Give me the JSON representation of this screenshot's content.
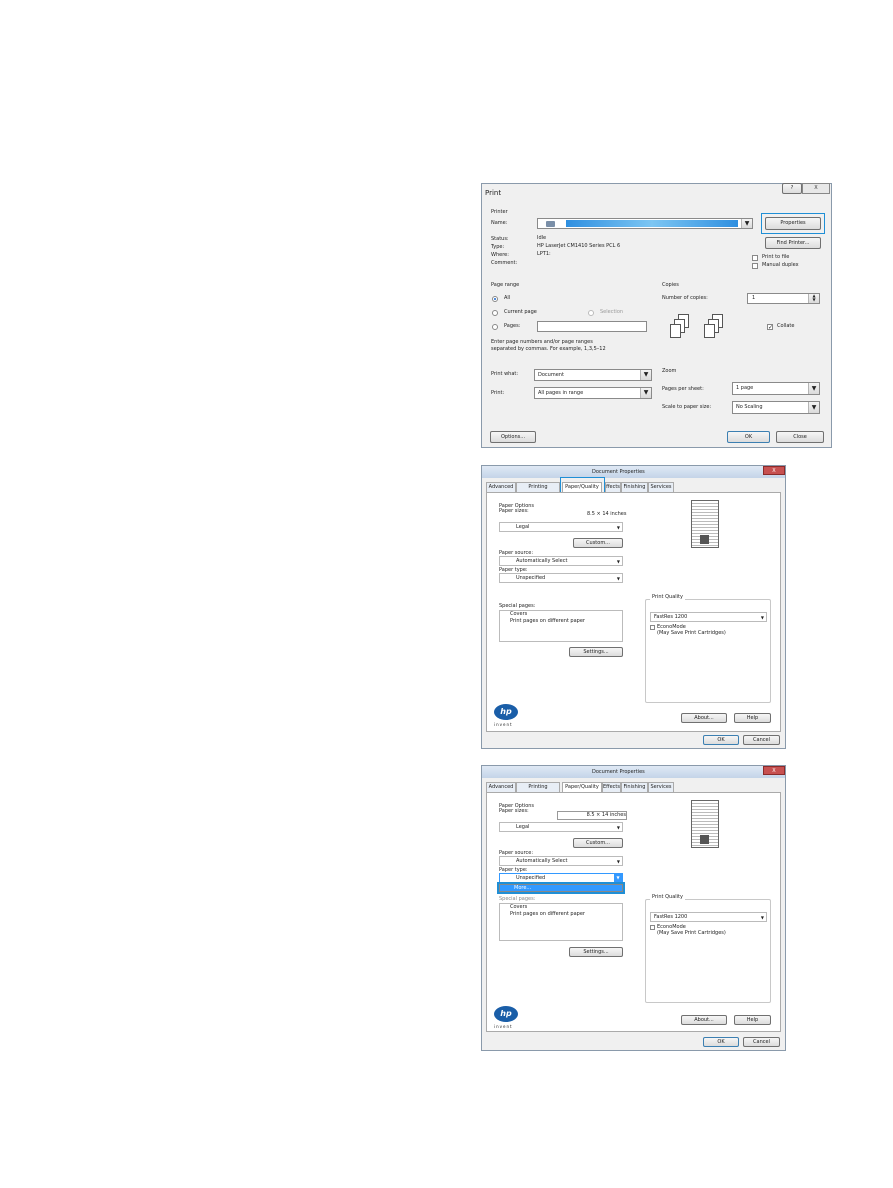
{
  "print_dialog": {
    "title": "Print",
    "help_glyph": "?",
    "close_glyph": "X",
    "printer_group": "Printer",
    "name_label": "Name:",
    "properties_button": "Properties",
    "status_label": "Status:",
    "status_value": "Idle",
    "type_label": "Type:",
    "type_value": "HP LaserJet CM1410 Series PCL 6",
    "where_label": "Where:",
    "where_value": "LPT1:",
    "comment_label": "Comment:",
    "find_printer_button": "Find Printer...",
    "print_to_file": "Print to file",
    "manual_duplex": "Manual duplex",
    "page_range_group": "Page range",
    "all": "All",
    "current_page": "Current page",
    "selection": "Selection",
    "pages": "Pages:",
    "range_help_1": "Enter page numbers and/or page ranges",
    "range_help_2": "separated by commas.  For example, 1,3,5–12",
    "copies_group": "Copies",
    "number_of_copies_label": "Number of copies:",
    "copies_value": "1",
    "collate": "Collate",
    "print_what_label": "Print what:",
    "print_what_value": "Document",
    "print_label": "Print:",
    "print_value": "All pages in range",
    "zoom_group": "Zoom",
    "pages_per_sheet_label": "Pages per sheet:",
    "pages_per_sheet_value": "1 page",
    "scale_label": "Scale to paper size:",
    "scale_value": "No Scaling",
    "options_button": "Options...",
    "ok_button": "OK",
    "close_button": "Close"
  },
  "doc_props": {
    "title": "Document Properties",
    "close_glyph": "X",
    "tabs": [
      "Advanced",
      "Printing Shortcuts",
      "Paper/Quality",
      "Effects",
      "Finishing",
      "Services"
    ],
    "tab_effects_clipped": "ffects",
    "paper_options": "Paper Options",
    "paper_sizes_label": "Paper sizes:",
    "paper_size_dims": "8.5 × 14 inches",
    "paper_size_value": "Legal",
    "custom_button": "Custom...",
    "paper_source_label": "Paper source:",
    "paper_source_value": "Automatically Select",
    "paper_type_label": "Paper type:",
    "paper_type_value": "Unspecified",
    "special_pages_label": "Special pages:",
    "special_pages_items": [
      "Covers",
      "Print pages on different paper"
    ],
    "settings_button": "Settings...",
    "print_quality_group": "Print Quality",
    "print_quality_value": "FastRes 1200",
    "econo_mode": "EconoMode",
    "econo_note": "(May Save Print Cartridges)",
    "hp_logo": "hp",
    "hp_tagline": "invent",
    "about_button": "About...",
    "help_button": "Help",
    "ok_button": "OK",
    "cancel_button": "Cancel",
    "dropdown_more": "More..."
  },
  "colors": {
    "highlight": "#1f8fd6",
    "selection_bar": "#3399ff",
    "close_red": "#c75050"
  },
  "icons": [
    "printer-icon",
    "dropdown-arrow-icon",
    "collate-pages-icon",
    "page-preview-icon",
    "hp-logo"
  ]
}
